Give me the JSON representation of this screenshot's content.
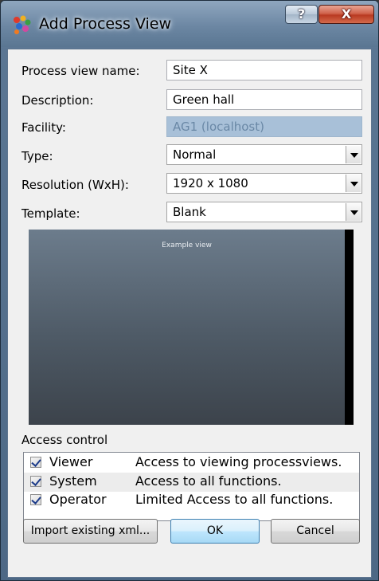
{
  "window": {
    "title": "Add Process View",
    "help_label": "?",
    "close_label": "X",
    "icon": "colorful-process-icon"
  },
  "form": {
    "name_label": "Process view name:",
    "name_value": "Site X",
    "description_label": "Description:",
    "description_value": "Green hall",
    "facility_label": "Facility:",
    "facility_value": "AG1 (localhost)",
    "type_label": "Type:",
    "type_value": "Normal",
    "resolution_label": "Resolution (WxH):",
    "resolution_value": "1920 x 1080",
    "template_label": "Template:",
    "template_value": "Blank"
  },
  "preview": {
    "caption": "Example view"
  },
  "access": {
    "label": "Access control",
    "rows": [
      {
        "name": "Viewer",
        "desc": "Access to viewing processviews.",
        "checked": true
      },
      {
        "name": "System",
        "desc": "Access to all functions.",
        "checked": true
      },
      {
        "name": "Operator",
        "desc": "Limited Access to all functions.",
        "checked": true
      }
    ]
  },
  "buttons": {
    "import": "Import existing xml...",
    "ok": "OK",
    "cancel": "Cancel"
  },
  "colors": {
    "titlebar": "#6c87a3",
    "close": "#c4452b",
    "disabled_field": "#a8c0d8",
    "ok_button": "#bee6fd"
  }
}
